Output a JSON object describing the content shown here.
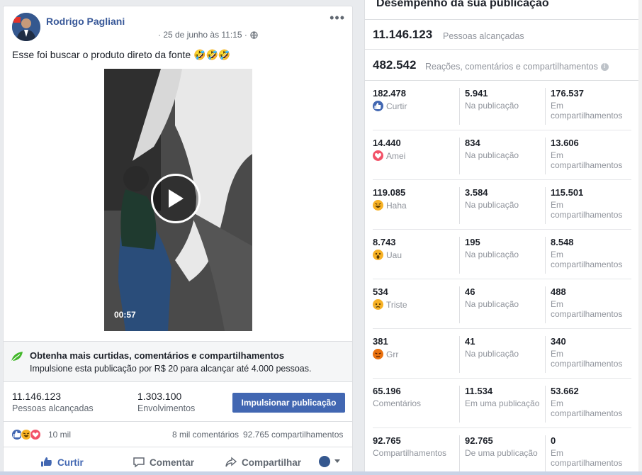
{
  "post": {
    "author": "Rodrigo Pagliani",
    "timestamp": "· 25 de junho às 11:15 ·",
    "text": "Esse foi buscar o produto direto da fonte 🤣🤣🤣",
    "video_duration": "00:57",
    "boost": {
      "title": "Obtenha mais curtidas, comentários e compartilhamentos",
      "subtitle": "Impulsione esta publicação por R$ 20 para alcançar até 4.000 pessoas."
    },
    "stats": {
      "reach_value": "11.146.123",
      "reach_label": "Pessoas alcançadas",
      "engagement_value": "1.303.100",
      "engagement_label": "Envolvimentos",
      "boost_button": "Impulsionar publicação"
    },
    "reactions": {
      "count": "10 mil",
      "comments": "8 mil comentários",
      "shares": "92.765 compartilhamentos"
    },
    "actions": {
      "like": "Curtir",
      "comment": "Comentar",
      "share": "Compartilhar"
    }
  },
  "insights": {
    "title": "Desempenho da sua publicação",
    "reach_value": "11.146.123",
    "reach_label": "Pessoas alcançadas",
    "engagement_value": "482.542",
    "engagement_label": "Reações, comentários e compartilhamentos",
    "rows": [
      {
        "total": "182.478",
        "label": "Curtir",
        "icon": "like-icon",
        "on_post": "5.941",
        "on_post_label": "Na publicação",
        "on_shares": "176.537",
        "on_shares_label": "Em compartilhamentos"
      },
      {
        "total": "14.440",
        "label": "Amei",
        "icon": "love-icon",
        "on_post": "834",
        "on_post_label": "Na publicação",
        "on_shares": "13.606",
        "on_shares_label": "Em compartilhamentos"
      },
      {
        "total": "119.085",
        "label": "Haha",
        "icon": "haha-icon",
        "on_post": "3.584",
        "on_post_label": "Na publicação",
        "on_shares": "115.501",
        "on_shares_label": "Em compartilhamentos"
      },
      {
        "total": "8.743",
        "label": "Uau",
        "icon": "wow-icon",
        "on_post": "195",
        "on_post_label": "Na publicação",
        "on_shares": "8.548",
        "on_shares_label": "Em compartilhamentos"
      },
      {
        "total": "534",
        "label": "Triste",
        "icon": "sad-icon",
        "on_post": "46",
        "on_post_label": "Na publicação",
        "on_shares": "488",
        "on_shares_label": "Em compartilhamentos"
      },
      {
        "total": "381",
        "label": "Grr",
        "icon": "angry-icon",
        "on_post": "41",
        "on_post_label": "Na publicação",
        "on_shares": "340",
        "on_shares_label": "Em compartilhamentos"
      },
      {
        "total": "65.196",
        "label": "Comentários",
        "icon": "",
        "on_post": "11.534",
        "on_post_label": "Em uma publicação",
        "on_shares": "53.662",
        "on_shares_label": "Em compartilhamentos"
      },
      {
        "total": "92.765",
        "label": "Compartilhamentos",
        "icon": "",
        "on_post": "92.765",
        "on_post_label": "De uma publicação",
        "on_shares": "0",
        "on_shares_label": "Em compartilhamentos"
      }
    ]
  },
  "colors": {
    "brand_blue": "#4267b2",
    "link_blue": "#385898",
    "love_red": "#f25268",
    "haha_yellow": "#f7b125",
    "angry_orange": "#e9710f"
  }
}
